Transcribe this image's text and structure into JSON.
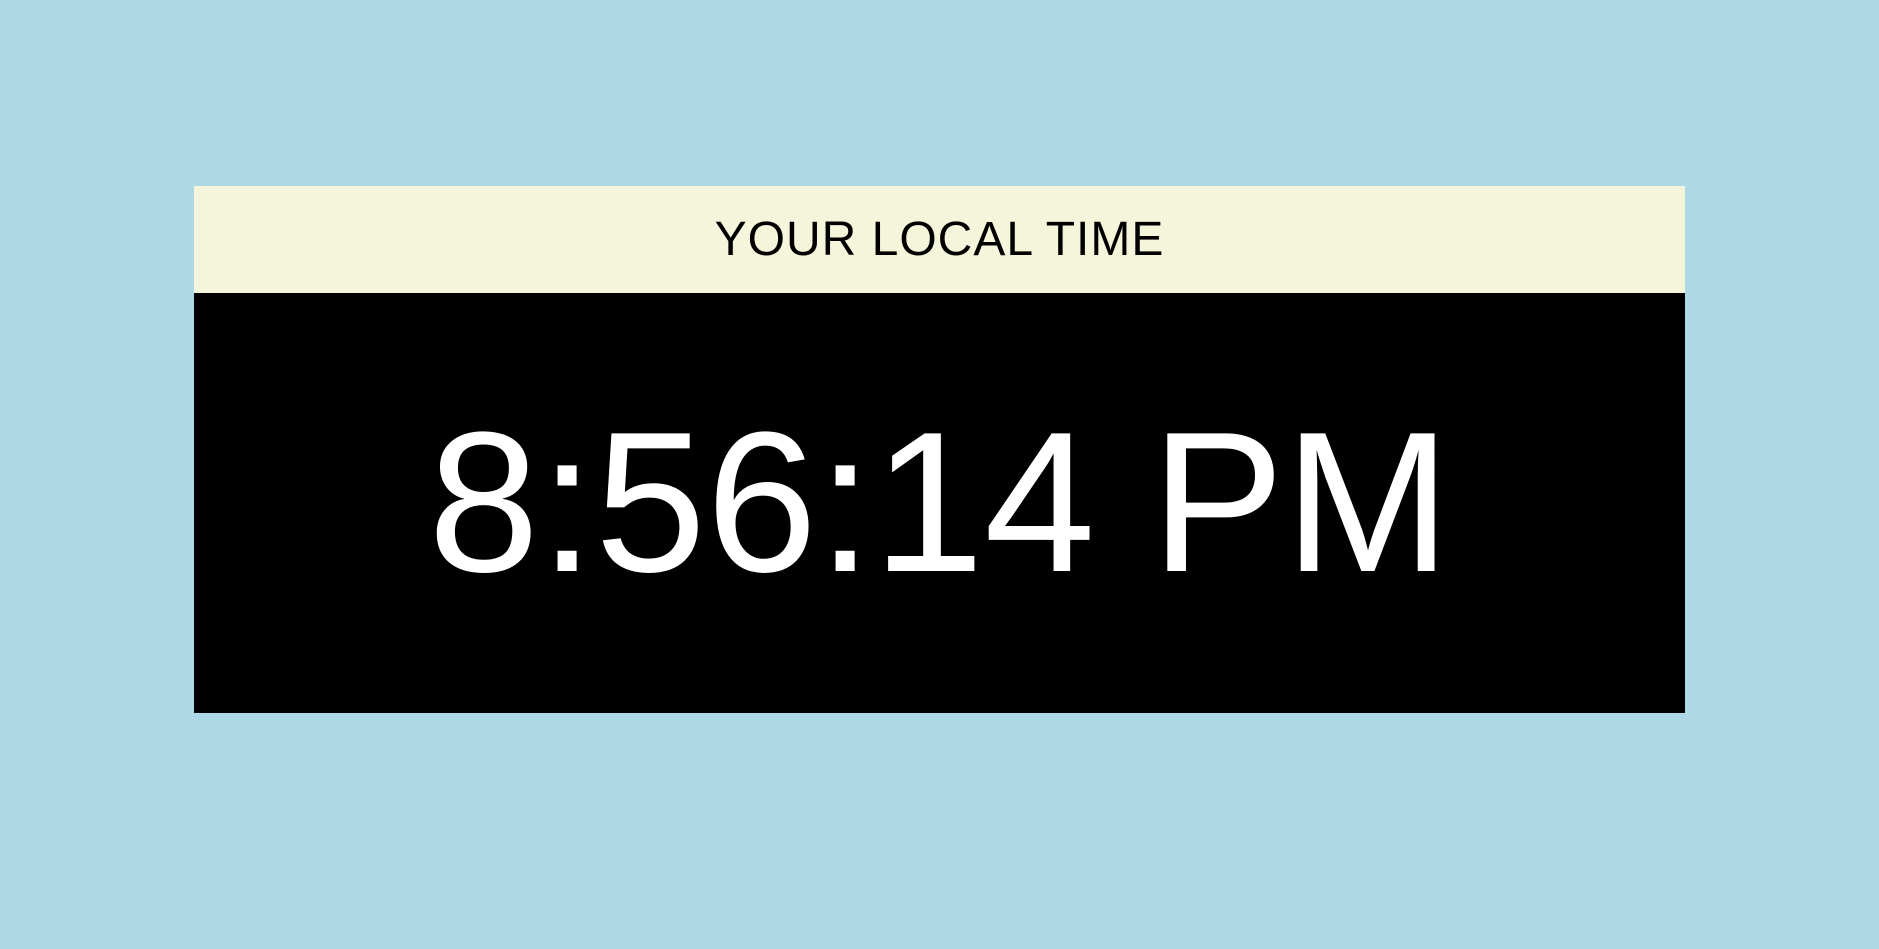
{
  "clock": {
    "title": "YOUR LOCAL TIME",
    "time": "8:56:14 PM"
  },
  "colors": {
    "page_background": "#ADD8E6",
    "header_background": "#F5F5DC",
    "body_background": "#000000",
    "title_color": "#000000",
    "time_color": "#FFFFFF"
  }
}
